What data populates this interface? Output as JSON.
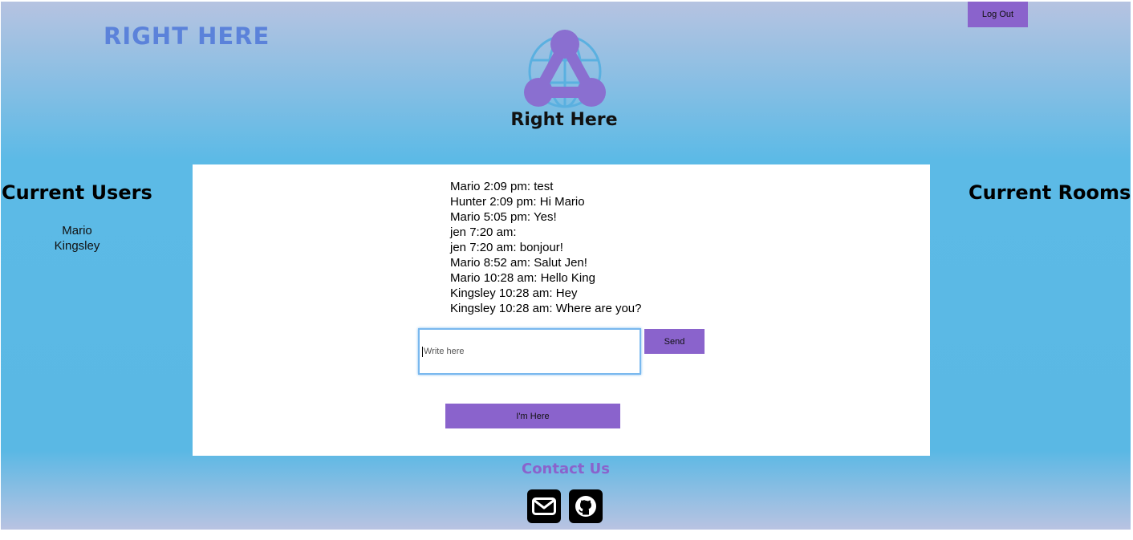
{
  "header": {
    "brand": "RIGHT HERE",
    "logout_label": "Log Out",
    "logo_title": "Right Here"
  },
  "sidebar_left": {
    "title": "Current Users",
    "users": [
      "Mario",
      "Kingsley"
    ]
  },
  "sidebar_right": {
    "title": "Current Rooms"
  },
  "chat": {
    "messages": [
      {
        "sender": "Mario",
        "time": "2:09 pm",
        "text": "test"
      },
      {
        "sender": "Hunter",
        "time": "2:09 pm",
        "text": "Hi Mario"
      },
      {
        "sender": "Mario",
        "time": "5:05 pm",
        "text": "Yes!"
      },
      {
        "sender": "jen",
        "time": "7:20 am",
        "text": ""
      },
      {
        "sender": "jen",
        "time": "7:20 am",
        "text": "bonjour!"
      },
      {
        "sender": "Mario",
        "time": "8:52 am",
        "text": "Salut Jen!"
      },
      {
        "sender": "Mario",
        "time": "10:28 am",
        "text": "Hello King"
      },
      {
        "sender": "Kingsley",
        "time": "10:28 am",
        "text": "Hey"
      },
      {
        "sender": "Kingsley",
        "time": "10:28 am",
        "text": "Where are you?"
      }
    ],
    "input_placeholder": "Write here",
    "send_label": "Send",
    "here_label": "I'm Here"
  },
  "footer": {
    "contact_title": "Contact Us",
    "icons": [
      "envelope-icon",
      "github-icon"
    ]
  },
  "colors": {
    "accent": "#8a63cc",
    "brand": "#5b82da",
    "logo": "#8a6fd0",
    "globe": "#5ab0e0"
  }
}
